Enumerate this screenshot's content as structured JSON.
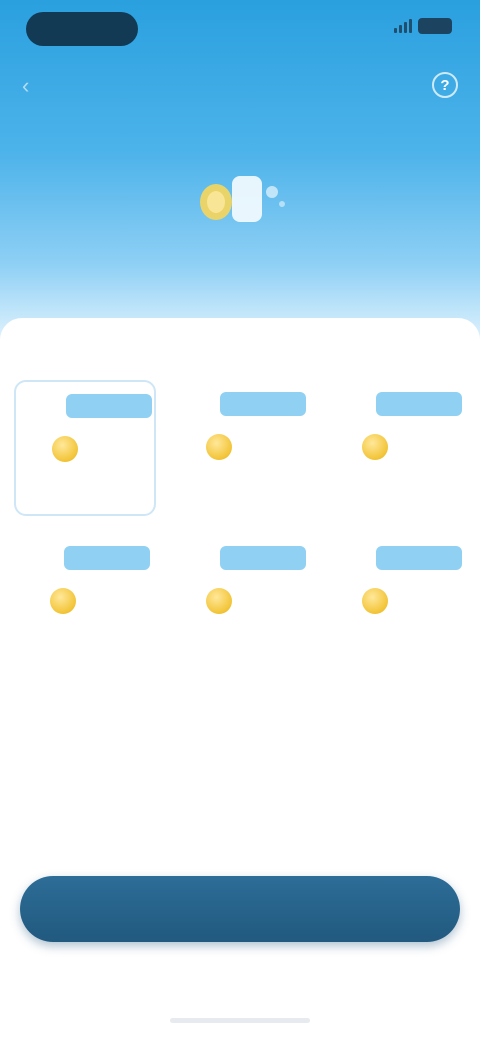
{
  "status_bar": {
    "time": ""
  },
  "header": {
    "title": ""
  },
  "section": {
    "title": ""
  },
  "packages": [
    {
      "label": "",
      "amount": "",
      "price": "",
      "selected": true
    },
    {
      "label": "",
      "amount": "",
      "price": "",
      "selected": false
    },
    {
      "label": "",
      "amount": "",
      "price": "",
      "selected": false
    },
    {
      "label": "",
      "amount": "",
      "price": "",
      "selected": false
    },
    {
      "label": "",
      "amount": "",
      "price": "",
      "selected": false
    },
    {
      "label": "",
      "amount": "",
      "price": "",
      "selected": false
    }
  ],
  "cta": {
    "label": ""
  },
  "colors": {
    "hero_top": "#2aa0df",
    "hero_bottom": "#dff2fd",
    "label_badge": "#8fd0f3",
    "coin_gold": "#f2c437",
    "button": "#21597f"
  },
  "icons": {
    "back": "back-arrow-icon",
    "info": "info-icon",
    "coin": "gold-coin-icon",
    "hero": "coin-stack-icon"
  }
}
